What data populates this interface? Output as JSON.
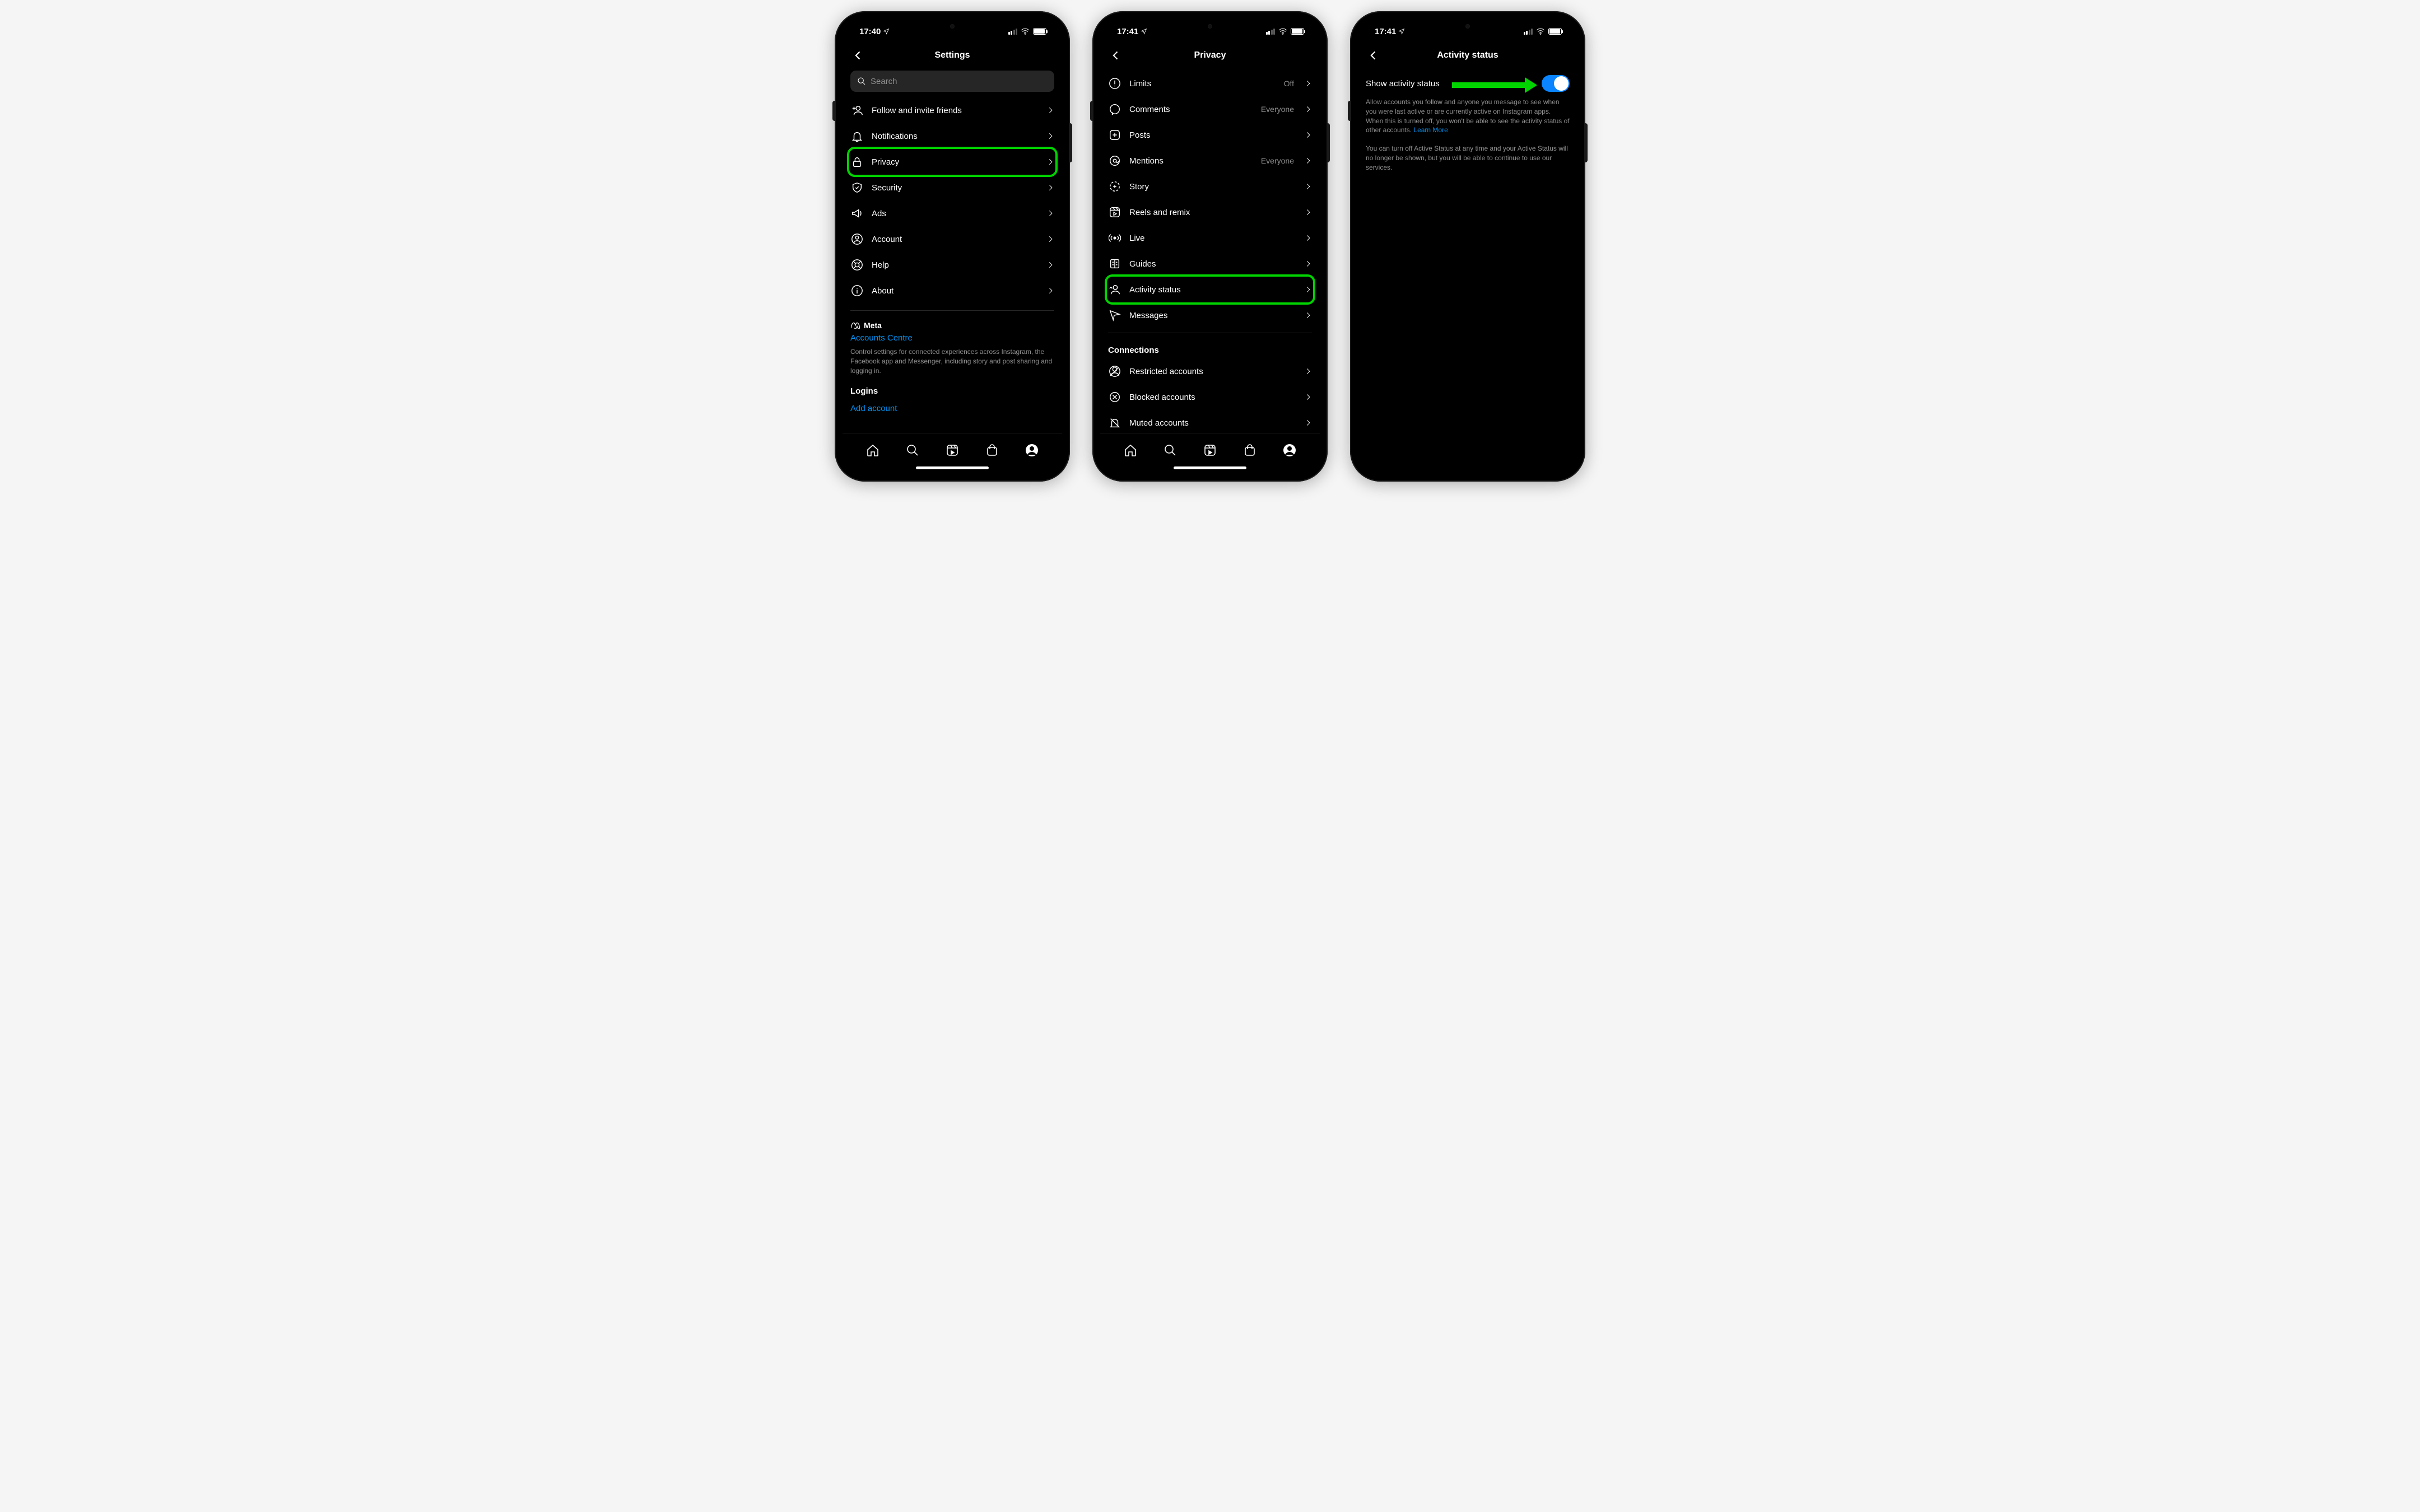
{
  "phone1": {
    "time": "17:40",
    "title": "Settings",
    "search_placeholder": "Search",
    "items": [
      {
        "icon": "follow-invite",
        "label": "Follow and invite friends"
      },
      {
        "icon": "bell",
        "label": "Notifications"
      },
      {
        "icon": "lock",
        "label": "Privacy",
        "highlight": true
      },
      {
        "icon": "shield",
        "label": "Security"
      },
      {
        "icon": "megaphone",
        "label": "Ads"
      },
      {
        "icon": "user-circle",
        "label": "Account"
      },
      {
        "icon": "life-ring",
        "label": "Help"
      },
      {
        "icon": "info",
        "label": "About"
      }
    ],
    "meta_label": "Meta",
    "accounts_centre": "Accounts Centre",
    "accounts_desc": "Control settings for connected experiences across Instagram, the Facebook app and Messenger, including story and post sharing and logging in.",
    "logins_heading": "Logins",
    "add_account": "Add account"
  },
  "phone2": {
    "time": "17:41",
    "title": "Privacy",
    "items": [
      {
        "icon": "limits",
        "label": "Limits",
        "value": "Off"
      },
      {
        "icon": "comment",
        "label": "Comments",
        "value": "Everyone"
      },
      {
        "icon": "plus-square",
        "label": "Posts"
      },
      {
        "icon": "at",
        "label": "Mentions",
        "value": "Everyone"
      },
      {
        "icon": "story",
        "label": "Story"
      },
      {
        "icon": "reels",
        "label": "Reels and remix"
      },
      {
        "icon": "live",
        "label": "Live"
      },
      {
        "icon": "guides",
        "label": "Guides"
      },
      {
        "icon": "activity",
        "label": "Activity status",
        "highlight": true
      },
      {
        "icon": "send",
        "label": "Messages"
      }
    ],
    "connections_heading": "Connections",
    "connections": [
      {
        "icon": "restricted",
        "label": "Restricted accounts"
      },
      {
        "icon": "blocked",
        "label": "Blocked accounts"
      },
      {
        "icon": "muted",
        "label": "Muted accounts"
      }
    ]
  },
  "phone3": {
    "time": "17:41",
    "title": "Activity status",
    "toggle_label": "Show activity status",
    "toggle_on": true,
    "desc1": "Allow accounts you follow and anyone you message to see when you were last active or are currently active on Instagram apps. When this is turned off, you won't be able to see the activity status of other accounts.",
    "learn_more": "Learn More",
    "desc2": "You can turn off Active Status at any time and your Active Status will no longer be shown, but you will be able to continue to use our services."
  },
  "annotation_color": "#00d300"
}
